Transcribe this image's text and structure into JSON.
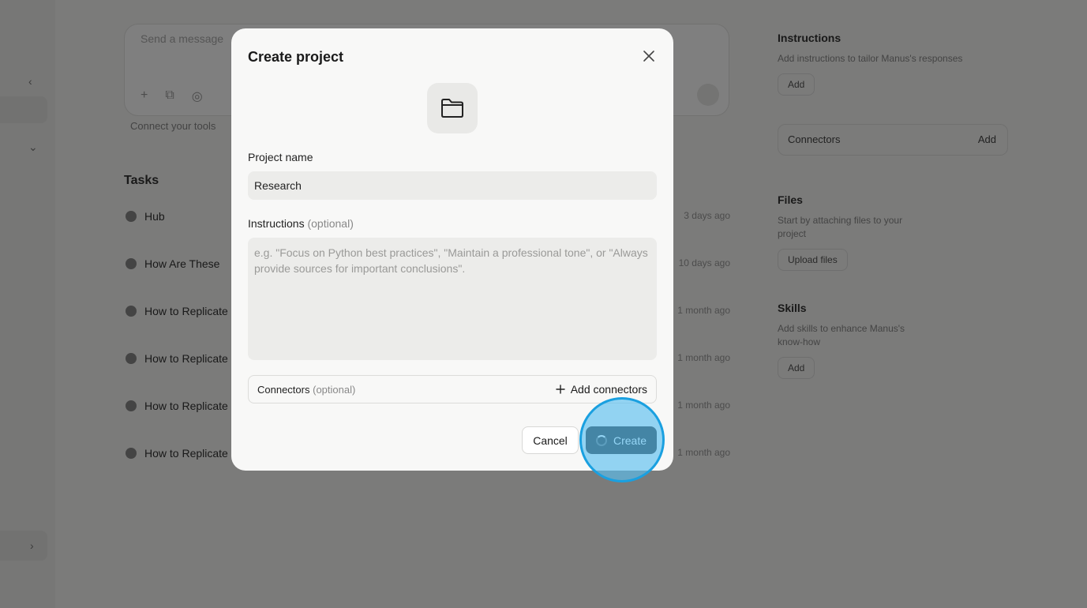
{
  "background": {
    "composer_placeholder": "Send a message",
    "connect_text": "Connect your tools",
    "tasks_title": "Tasks",
    "tasks_filter": "",
    "tasks": [
      {
        "title": "Hub",
        "date": "3 days ago"
      },
      {
        "title": "How Are These",
        "date": "10 days ago"
      },
      {
        "title": "How to Replicate",
        "date": "1 month ago"
      },
      {
        "title": "How to Replicate",
        "date": "1 month ago"
      },
      {
        "title": "How to Replicate",
        "date": "1 month ago"
      },
      {
        "title": "How to Replicate",
        "date": "1 month ago"
      }
    ],
    "right_panel": {
      "instructions_head": "Instructions",
      "instructions_sub": "Add instructions to tailor Manus's responses",
      "add_label": "Add",
      "connectors_label": "Connectors",
      "connectors_add": "Add",
      "files_head": "Files",
      "files_sub": "Start by attaching files to your project",
      "upload_label": "Upload files",
      "skills_head": "Skills",
      "skills_sub": "Add skills to enhance Manus's know-how",
      "skills_add": "Add"
    }
  },
  "modal": {
    "title": "Create project",
    "project_name_label": "Project name",
    "project_name_value": "Research",
    "instructions_label": "Instructions",
    "optional_tag": "(optional)",
    "instructions_placeholder": "e.g. \"Focus on Python best practices\", \"Maintain a professional tone\", or \"Always provide sources for important conclusions\".",
    "connectors_label": "Connectors",
    "connectors_optional": "(optional)",
    "add_connectors_label": "Add connectors",
    "cancel_label": "Cancel",
    "create_label": "Create"
  },
  "icons": {
    "close": "close-icon",
    "folder": "folder-icon",
    "plus": "plus-icon",
    "spinner": "spinner-icon"
  },
  "colors": {
    "primary_button": "#1a1a1a",
    "highlight": "#1aa0e0"
  }
}
